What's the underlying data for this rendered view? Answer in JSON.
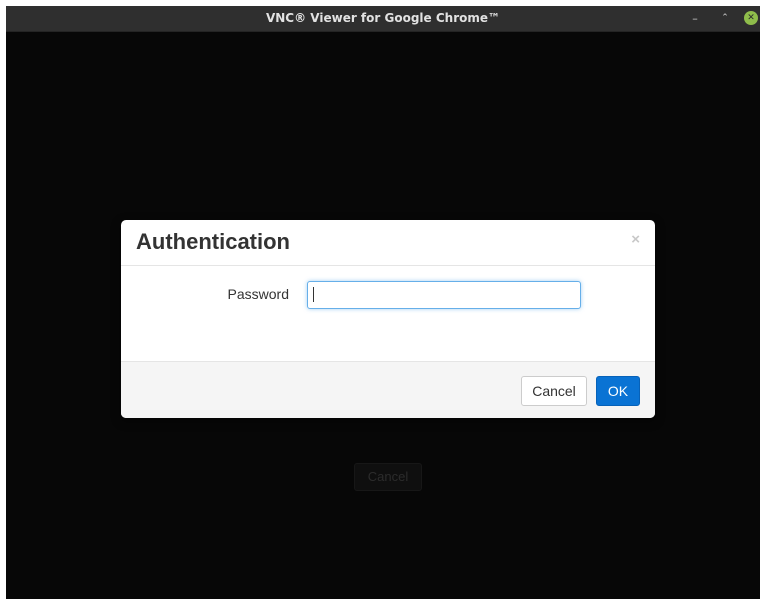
{
  "window": {
    "title": "VNC® Viewer for Google Chrome™",
    "controls": {
      "minimize": "–",
      "restore": "⌃",
      "close": "✕"
    }
  },
  "background": {
    "cancel_label": "Cancel"
  },
  "dialog": {
    "title": "Authentication",
    "close_glyph": "×",
    "password_label": "Password",
    "password_value": "",
    "password_placeholder": "",
    "cancel_label": "Cancel",
    "ok_label": "OK"
  },
  "colors": {
    "titlebar": "#2f2f2f",
    "content_bg": "#070707",
    "ok_button": "#0a73d4",
    "focus_ring": "#66afe9",
    "close_dot": "#8fbd4b"
  }
}
